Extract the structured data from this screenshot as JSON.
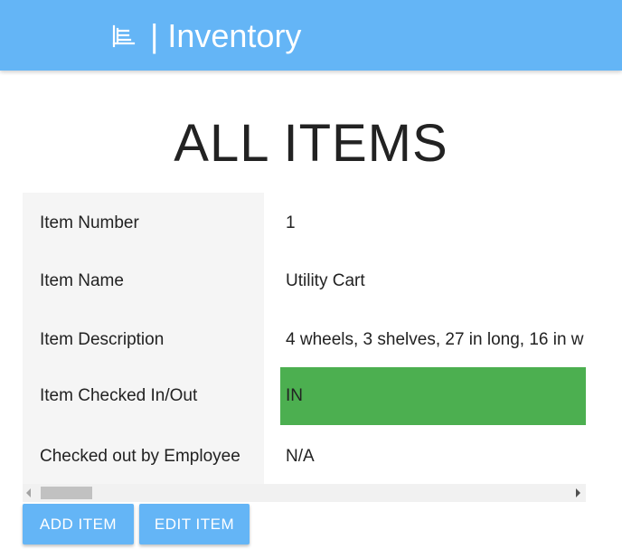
{
  "header": {
    "logo_icon": "hand-truck-icon",
    "title": "| Inventory",
    "color": "#64b5f6"
  },
  "page": {
    "title": "ALL ITEMS"
  },
  "item": {
    "rows": [
      {
        "label": "Item Number",
        "value": "1"
      },
      {
        "label": "Item Name",
        "value": "Utility Cart"
      },
      {
        "label": "Item Description",
        "value": "4 wheels, 3 shelves, 27 in long, 16 in w"
      },
      {
        "label": "Item Checked In/Out",
        "value": "IN",
        "status_color": "#4caf50"
      },
      {
        "label": "Checked out by Employee",
        "value": "N/A"
      }
    ]
  },
  "actions": {
    "add_label": "ADD ITEM",
    "edit_label": "EDIT ITEM"
  }
}
